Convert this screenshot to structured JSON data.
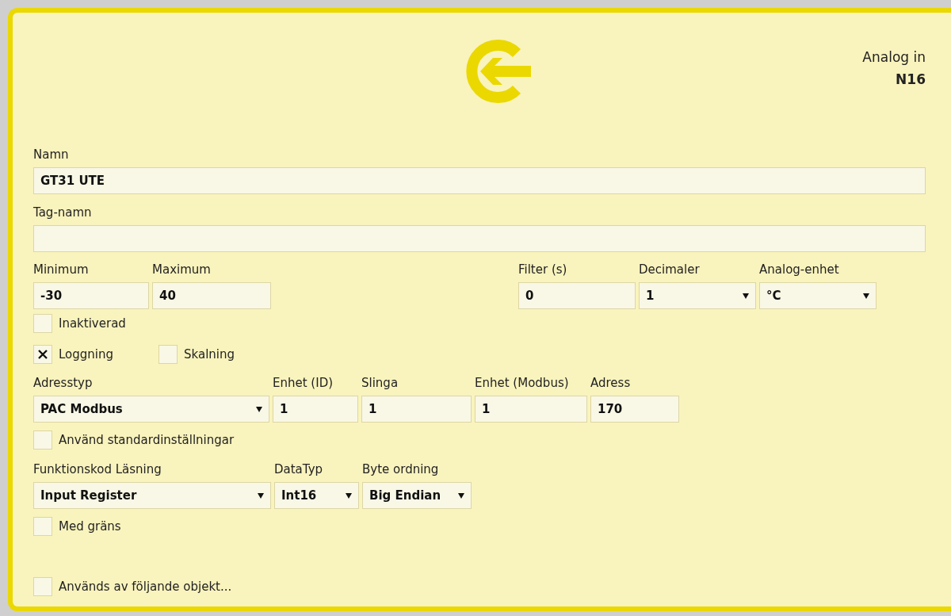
{
  "header": {
    "title": "Analog in",
    "code": "N16"
  },
  "rows": [
    {
      "items": [
        {
          "kind": "input",
          "label": "Namn",
          "value": "GT31 UTE"
        }
      ]
    },
    {
      "items": [
        {
          "kind": "input",
          "label": "Tag-namn"
        }
      ]
    },
    {
      "items": [
        {
          "kind": "input",
          "label": "Minimum",
          "value": "-30"
        },
        {
          "kind": "input",
          "label": "Maximum",
          "value": "40"
        },
        {
          "kind": "input",
          "label": "Filter (s)",
          "value": "0"
        },
        {
          "kind": "select",
          "label": "Decimaler",
          "value": "1"
        },
        {
          "kind": "select",
          "label": "Analog-enhet",
          "value": "°C"
        }
      ]
    },
    {
      "items": [
        {
          "kind": "checkbox",
          "label": "Inaktiverad",
          "checked": false
        }
      ]
    },
    {
      "items": [
        {
          "kind": "checkbox",
          "label": "Loggning",
          "checked": true
        },
        {
          "kind": "checkbox",
          "label": "Skalning",
          "checked": false
        }
      ]
    },
    {
      "items": [
        {
          "kind": "select",
          "label": "Adresstyp",
          "value": "PAC Modbus"
        },
        {
          "kind": "input",
          "label": "Enhet (ID)",
          "value": "1"
        },
        {
          "kind": "input",
          "label": "Slinga",
          "value": "1"
        },
        {
          "kind": "input",
          "label": "Enhet (Modbus)",
          "value": "1"
        },
        {
          "kind": "input",
          "label": "Adress",
          "value": "170"
        }
      ]
    },
    {
      "items": [
        {
          "kind": "checkbox",
          "label": "Använd standardinställningar",
          "checked": false
        }
      ]
    },
    {
      "items": [
        {
          "kind": "select",
          "label": "Funktionskod Läsning",
          "value": "Input Register"
        },
        {
          "kind": "select",
          "label": "DataTyp",
          "value": "Int16"
        },
        {
          "kind": "select",
          "label": "Byte ordning",
          "value": "Big Endian"
        }
      ]
    },
    {
      "items": [
        {
          "kind": "checkbox",
          "label": "Med gräns",
          "checked": false
        }
      ]
    },
    {
      "items": [
        {
          "kind": "checkbox",
          "label": "Används av följande objekt...",
          "checked": false
        }
      ]
    }
  ]
}
